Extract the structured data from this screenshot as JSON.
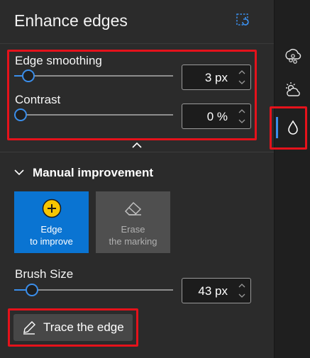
{
  "panel": {
    "title": "Enhance edges",
    "header_icon": "crop-refresh-icon"
  },
  "sliders": {
    "edge_smoothing": {
      "label": "Edge smoothing",
      "value": "3 px",
      "level": 0.08
    },
    "contrast": {
      "label": "Contrast",
      "value": "0 %",
      "level": 0.0
    }
  },
  "manual": {
    "title": "Manual improvement",
    "tools": [
      {
        "label_line1": "Edge",
        "label_line2": "to improve",
        "icon": "plus-circle-icon",
        "active": true
      },
      {
        "label_line1": "Erase",
        "label_line2": "the marking",
        "icon": "eraser-icon",
        "active": false
      }
    ],
    "brush": {
      "label": "Brush Size",
      "value": "43 px",
      "level": 0.11
    },
    "trace_button": "Trace the edge"
  },
  "rail": {
    "items": [
      {
        "icon": "background-blur-icon",
        "active": false
      },
      {
        "icon": "weather-partly-cloudy-icon",
        "active": false
      },
      {
        "icon": "droplet-icon",
        "active": true
      }
    ]
  },
  "colors": {
    "accent": "#3b8eea",
    "button_blue": "#0a74d2",
    "highlight": "#e5121b",
    "plus_yellow": "#f7c600"
  }
}
